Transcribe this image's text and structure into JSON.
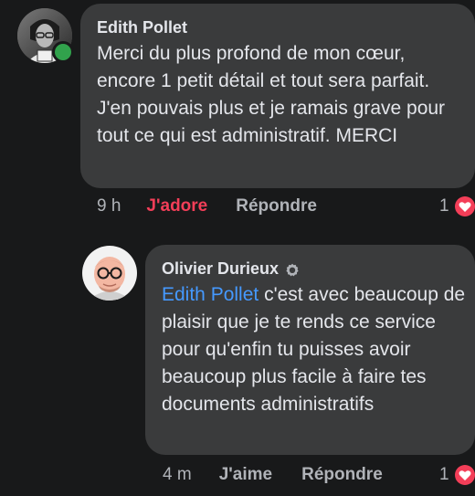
{
  "comment": {
    "author": "Edith Pollet",
    "text": "Merci du plus profond de mon cœur, encore 1 petit détail et tout sera parfait. J'en pouvais plus et je ramais grave pour tout ce qui est administratif. MERCI",
    "time": "9 h",
    "like_label": "J'adore",
    "reply_label": "Répondre",
    "reaction_count": "1",
    "reaction_icon": "heart-icon",
    "online": true
  },
  "reply": {
    "author": "Olivier Durieux",
    "badge_icon": "top-fan-badge-icon",
    "mention": "Edith Pollet",
    "text": " c'est avec beaucoup de plaisir que je te rends ce service pour qu'enfin tu puisses avoir beaucoup plus facile à faire tes documents administratifs",
    "time": "4 m",
    "like_label": "J'aime",
    "reply_label": "Répondre",
    "reaction_count": "1",
    "reaction_icon": "heart-icon"
  },
  "colors": {
    "background": "#18191a",
    "bubble": "#3a3b3c",
    "text": "#e4e6eb",
    "secondary": "#b0b3b8",
    "love": "#f33e58",
    "mention": "#4599ff",
    "online": "#31a24c"
  }
}
